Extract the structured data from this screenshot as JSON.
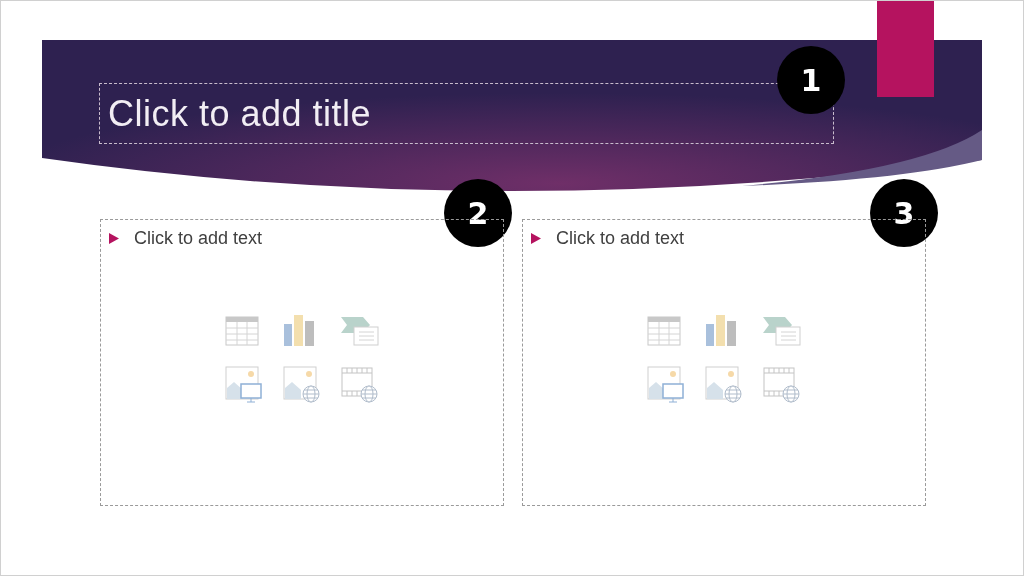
{
  "title_placeholder": {
    "text": "Click to add title",
    "callout": "1"
  },
  "content_placeholders": [
    {
      "text": "Click to add text",
      "callout": "2"
    },
    {
      "text": "Click to add text",
      "callout": "3"
    }
  ]
}
